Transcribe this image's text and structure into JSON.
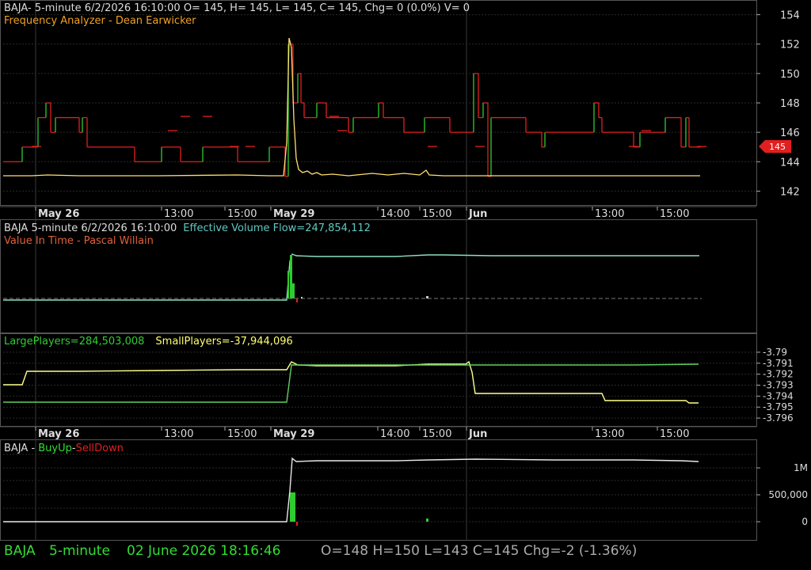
{
  "panel1": {
    "header": "BAJA- 5-minute 6/2/2026 16:10:00 O= 145, H= 145, L= 145, C= 145, Chg= 0 (0.0%) V= 0",
    "study_title": "Frequency Analyzer - Dean Earwicker",
    "price_tag": "145"
  },
  "panel2": {
    "header_prefix": "BAJA 5-minute  6/2/2026 16:10:00",
    "header_value": "Effective Volume Flow=247,854,112",
    "study_title": "Value In Time - Pascal Willain"
  },
  "panel3": {
    "large_players": "LargePlayers=284,503,008",
    "small_players": "SmallPlayers=-37,944,096"
  },
  "panel4": {
    "prefix": "BAJA - ",
    "buy": "BuyUp",
    "dash": "-",
    "sell": "SellDown"
  },
  "status_bar": {
    "symbol": "BAJA",
    "interval": "5-minute",
    "timestamp": "02 June 2026 18:16:46",
    "ohlc": "O=148  H=150  L=143  C=145  Chg=-2 (-1.36%)"
  },
  "colors": {
    "price_up": "#2ecc2e",
    "price_down": "#e02020",
    "oscillator": "#ffe070",
    "evf": "#8fe0c0",
    "small_players": "#ffff90",
    "large_players": "#60d060",
    "grid": "#303030",
    "status_green": "#33dd33"
  },
  "chart_data": [
    {
      "type": "line",
      "title": "Frequency Analyzer - Dean Earwicker",
      "ylim": [
        141,
        155
      ],
      "yticks": [
        "154",
        "152",
        "150",
        "148",
        "146",
        "144",
        "142"
      ],
      "xticks": [
        "May 26",
        "13:00",
        "15:00",
        "May 29",
        "14:00",
        "15:00",
        "Jun",
        "13:00",
        "15:00"
      ],
      "series": [
        {
          "name": "price_up_segments",
          "values": [
            [
              0.02,
              144,
              144
            ],
            [
              0.06,
              145,
              147
            ],
            [
              0.1,
              147,
              145
            ],
            [
              0.2,
              144,
              145
            ],
            [
              0.37,
              143,
              152
            ],
            [
              0.39,
              150,
              148
            ],
            [
              0.47,
              146,
              147
            ],
            [
              0.64,
              147,
              148
            ],
            [
              0.72,
              146,
              146
            ],
            [
              0.84,
              146,
              148
            ],
            [
              0.96,
              145,
              147
            ]
          ]
        },
        {
          "name": "price_down_segments",
          "values": [
            [
              0.07,
              149,
              146
            ],
            [
              0.11,
              147,
              145
            ],
            [
              0.25,
              145,
              144
            ],
            [
              0.38,
              152,
              148
            ],
            [
              0.42,
              148,
              147
            ],
            [
              0.6,
              147,
              146
            ],
            [
              0.68,
              150,
              147
            ],
            [
              0.7,
              147,
              143
            ],
            [
              0.74,
              147,
              146
            ]
          ]
        }
      ]
    },
    {
      "type": "line",
      "title": "Value In Time - Pascal Willain",
      "series": [
        {
          "name": "Effective Volume Flow",
          "values": [
            0,
            0,
            0,
            0,
            0,
            0,
            0,
            0,
            0,
            0,
            0,
            0,
            0,
            0,
            0,
            0,
            0,
            0,
            0,
            0,
            247854112,
            247854112,
            247854112,
            247854112,
            247854112,
            247854112,
            247854112,
            247854112,
            247854112,
            247854112,
            247854112,
            247854112,
            247854112
          ]
        }
      ]
    },
    {
      "type": "line",
      "ylim": [
        -3.7965,
        -3.7895
      ],
      "yticks": [
        "-3.79",
        "-3.791",
        "-3.792",
        "-3.793",
        "-3.794",
        "-3.795",
        "-3.796"
      ],
      "series": [
        {
          "name": "LargePlayers",
          "values": [
            -3.7945,
            -3.7945,
            -3.7945,
            -3.7945,
            -3.7945,
            -3.7945,
            -3.7945,
            -3.7945,
            -3.7945,
            -3.7912,
            -3.7913,
            -3.7913,
            -3.7913,
            -3.7913,
            -3.7913,
            -3.7913
          ]
        },
        {
          "name": "SmallPlayers",
          "values": [
            -3.7928,
            -3.792,
            -3.792,
            -3.792,
            -3.792,
            -3.792,
            -3.792,
            -3.792,
            -3.792,
            -3.7911,
            -3.7912,
            -3.7912,
            -3.7911,
            -3.7911,
            -3.791,
            -3.7938,
            -3.7938,
            -3.7938,
            -3.7943,
            -3.7943,
            -3.7945
          ]
        }
      ]
    },
    {
      "type": "line",
      "title": "BAJA - BuyUp-SellDown",
      "yticks": [
        "1M",
        "500,000",
        "0"
      ],
      "ylim": [
        -100000,
        1400000
      ],
      "series": [
        {
          "name": "BuyUp-SellDown",
          "values": [
            0,
            0,
            0,
            0,
            0,
            0,
            0,
            0,
            0,
            0,
            0,
            0,
            0,
            0,
            0,
            0,
            0,
            0,
            1200000,
            1150000,
            1150000,
            1155000,
            1155000,
            1150000,
            1150000,
            1150000,
            1145000,
            1140000
          ]
        }
      ]
    }
  ]
}
